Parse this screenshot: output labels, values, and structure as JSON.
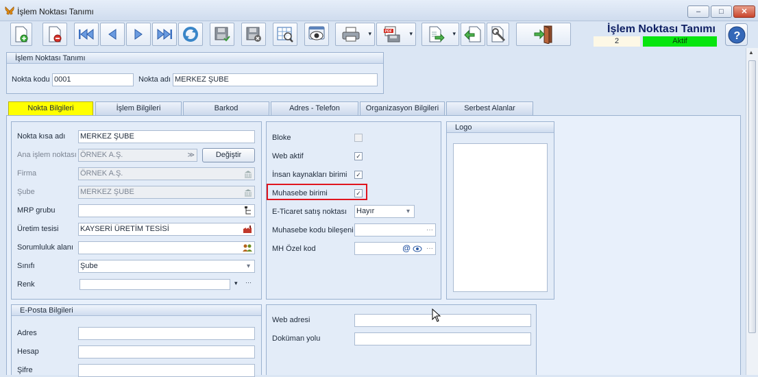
{
  "window": {
    "title": "İşlem Noktası Tanımı",
    "minimize": "–",
    "maximize": "□",
    "close": "✕"
  },
  "header": {
    "heading": "İşlem Noktası Tanımı",
    "record_no": "2",
    "status": "Aktif",
    "status_color": "#07e50f"
  },
  "toolbar": {
    "icons": [
      "new-record-icon",
      "delete-record-icon",
      "first-record-icon",
      "previous-record-icon",
      "next-record-icon",
      "last-record-icon",
      "refresh-icon",
      "save-icon",
      "cancel-save-icon",
      "preview-icon",
      "view-icon",
      "print-icon",
      "pdf-export-icon",
      "export-icon",
      "back-icon",
      "settings-icon",
      "exit-door-icon",
      "help-icon"
    ]
  },
  "top_group": {
    "title": "İşlem Noktası Tanımı",
    "code_label": "Nokta kodu",
    "code_value": "0001",
    "name_label": "Nokta adı",
    "name_value": "MERKEZ ŞUBE"
  },
  "tabs": [
    {
      "label": "Nokta Bilgileri",
      "active": true
    },
    {
      "label": "İşlem Bilgileri"
    },
    {
      "label": "Barkod"
    },
    {
      "label": "Adres - Telefon"
    },
    {
      "label": "Organizasyon Bilgileri"
    },
    {
      "label": "Serbest Alanlar"
    }
  ],
  "left_form": {
    "short_name": {
      "label": "Nokta kısa adı",
      "value": "MERKEZ ŞUBE"
    },
    "main_point": {
      "label": "Ana işlem noktası",
      "value": "ÖRNEK A.Ş.",
      "button": "Değiştir"
    },
    "company": {
      "label": "Firma",
      "value": "ÖRNEK A.Ş."
    },
    "branch": {
      "label": "Şube",
      "value": "MERKEZ ŞUBE"
    },
    "mrp_group": {
      "label": "MRP grubu",
      "value": ""
    },
    "plant": {
      "label": "Üretim tesisi",
      "value": "KAYSERİ ÜRETİM TESİSİ"
    },
    "responsibility": {
      "label": "Sorumluluk alanı",
      "value": ""
    },
    "class": {
      "label": "Sınıfı",
      "value": "Şube"
    },
    "color": {
      "label": "Renk",
      "value": ""
    }
  },
  "middle_form": {
    "blocked": {
      "label": "Bloke",
      "checked": false
    },
    "web_active": {
      "label": "Web aktif",
      "checked": true
    },
    "hr_unit": {
      "label": "İnsan kaynakları birimi",
      "checked": true
    },
    "accounting_unit": {
      "label": "Muhasebe birimi",
      "checked": true
    },
    "ecommerce": {
      "label": "E-Ticaret satış noktası",
      "value": "Hayır"
    },
    "accounting_code": {
      "label": "Muhasebe kodu bileşeni",
      "value": ""
    },
    "special_code": {
      "label": "MH Özel kod",
      "value": ""
    }
  },
  "logo_group": {
    "title": "Logo"
  },
  "email_group": {
    "title": "E-Posta Bilgileri",
    "address_label": "Adres",
    "account_label": "Hesap",
    "password_label": "Şifre"
  },
  "web_group": {
    "web_label": "Web adresi",
    "web_value": "",
    "doc_label": "Doküman yolu",
    "doc_value": ""
  },
  "glyphs": {
    "check": "✓",
    "dropdown": "▾",
    "ellipsis": "···",
    "at": "@",
    "chevrons": "≫"
  }
}
